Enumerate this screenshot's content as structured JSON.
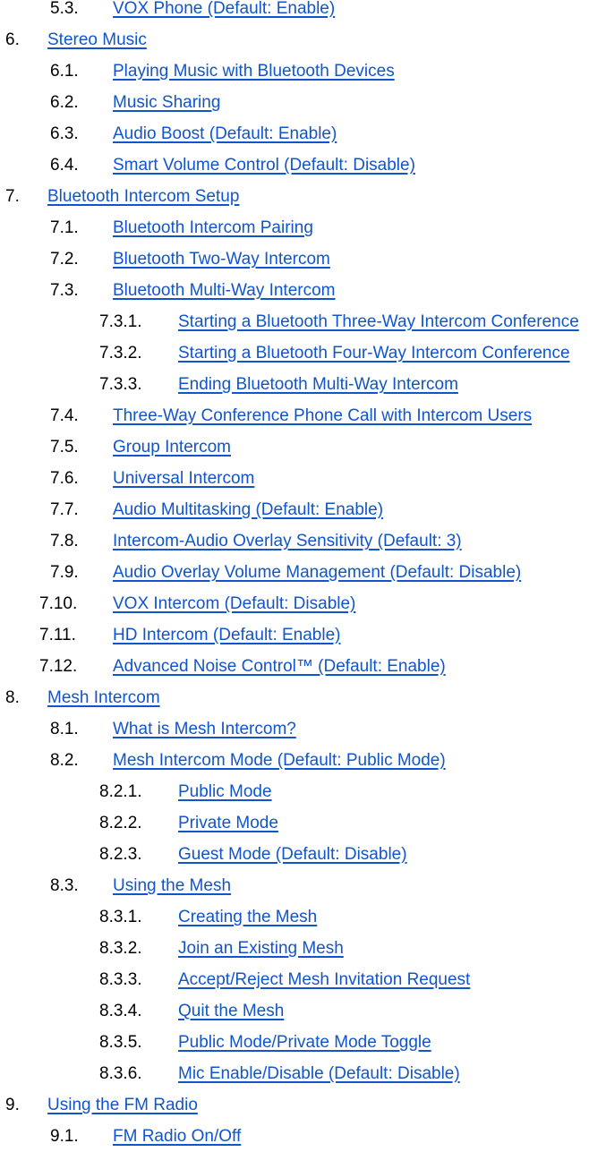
{
  "toc": {
    "link_color": "#1155cc",
    "entries": [
      {
        "num": "5.3.",
        "title": "VOX Phone (Default: Enable)",
        "level": "l2"
      },
      {
        "num": "6.",
        "title": "Stereo Music",
        "level": "l1"
      },
      {
        "num": "6.1.",
        "title": "Playing Music with Bluetooth Devices",
        "level": "l2"
      },
      {
        "num": "6.2.",
        "title": "Music Sharing",
        "level": "l2"
      },
      {
        "num": "6.3.",
        "title": "Audio Boost (Default: Enable)",
        "level": "l2"
      },
      {
        "num": "6.4.",
        "title": "Smart Volume Control (Default: Disable)",
        "level": "l2"
      },
      {
        "num": "7.",
        "title": "Bluetooth Intercom Setup",
        "level": "l1"
      },
      {
        "num": "7.1.",
        "title": "Bluetooth Intercom Pairing",
        "level": "l2"
      },
      {
        "num": "7.2.",
        "title": "Bluetooth Two-Way Intercom",
        "level": "l2"
      },
      {
        "num": "7.3.",
        "title": "Bluetooth Multi-Way Intercom",
        "level": "l2"
      },
      {
        "num": "7.3.1.",
        "title": "Starting a Bluetooth Three-Way Intercom Conference",
        "level": "l3"
      },
      {
        "num": "7.3.2.",
        "title": "Starting a Bluetooth Four-Way Intercom Conference",
        "level": "l3"
      },
      {
        "num": "7.3.3.",
        "title": "Ending Bluetooth Multi-Way Intercom",
        "level": "l3"
      },
      {
        "num": "7.4.",
        "title": "Three-Way Conference Phone Call with Intercom Users",
        "level": "l2"
      },
      {
        "num": "7.5.",
        "title": "Group Intercom",
        "level": "l2"
      },
      {
        "num": "7.6.",
        "title": "Universal Intercom",
        "level": "l2"
      },
      {
        "num": "7.7.",
        "title": "Audio Multitasking (Default: Enable)",
        "level": "l2"
      },
      {
        "num": "7.8.",
        "title": "Intercom-Audio Overlay Sensitivity (Default: 3)",
        "level": "l2"
      },
      {
        "num": "7.9.",
        "title": "Audio Overlay Volume Management (Default: Disable)",
        "level": "l2"
      },
      {
        "num": "7.10.",
        "title": "VOX Intercom (Default: Disable)",
        "level": "l2w"
      },
      {
        "num": "7.11.",
        "title": "HD Intercom (Default: Enable)",
        "level": "l2w"
      },
      {
        "num": "7.12.",
        "title": "Advanced Noise Control™ (Default: Enable)",
        "level": "l2w"
      },
      {
        "num": "8.",
        "title": "Mesh Intercom",
        "level": "l1"
      },
      {
        "num": "8.1.",
        "title": "What is Mesh Intercom?",
        "level": "l2"
      },
      {
        "num": "8.2.",
        "title": "Mesh Intercom Mode (Default: Public Mode)",
        "level": "l2"
      },
      {
        "num": "8.2.1.",
        "title": "Public Mode",
        "level": "l3"
      },
      {
        "num": "8.2.2.",
        "title": "Private Mode",
        "level": "l3"
      },
      {
        "num": "8.2.3.",
        "title": "Guest Mode (Default: Disable)",
        "level": "l3"
      },
      {
        "num": "8.3.",
        "title": "Using the Mesh",
        "level": "l2"
      },
      {
        "num": "8.3.1.",
        "title": "Creating the Mesh",
        "level": "l3"
      },
      {
        "num": "8.3.2.",
        "title": "Join an Existing Mesh",
        "level": "l3"
      },
      {
        "num": "8.3.3.",
        "title": "Accept/Reject Mesh Invitation Request",
        "level": "l3"
      },
      {
        "num": "8.3.4.",
        "title": "Quit the Mesh",
        "level": "l3"
      },
      {
        "num": "8.3.5.",
        "title": "Public Mode/Private Mode Toggle",
        "level": "l3"
      },
      {
        "num": "8.3.6.",
        "title": "Mic Enable/Disable (Default: Disable)",
        "level": "l3"
      },
      {
        "num": "9.",
        "title": "Using the FM Radio",
        "level": "l1"
      },
      {
        "num": "9.1.",
        "title": "FM Radio On/Off",
        "level": "l2"
      }
    ]
  }
}
